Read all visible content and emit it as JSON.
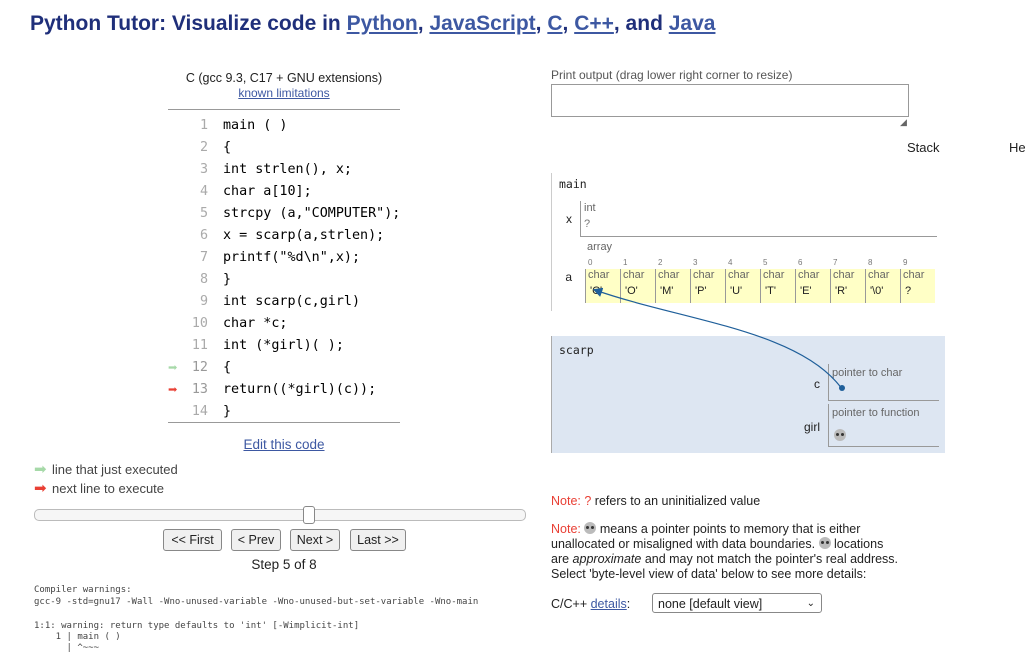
{
  "header": {
    "prefix": "Python Tutor: Visualize code in ",
    "lang1": "Python",
    "sep1": ", ",
    "lang2": "JavaScript",
    "sep2": ", ",
    "lang3": "C",
    "sep3": ", ",
    "lang4": "C++",
    "sep4": ", and ",
    "lang5": "Java"
  },
  "editor": {
    "language": "C (gcc 9.3, C17 + GNU extensions)",
    "limitations_link": "known limitations",
    "lines": [
      {
        "n": "1",
        "code": "main ( )"
      },
      {
        "n": "2",
        "code": "{"
      },
      {
        "n": "3",
        "code": "int strlen(), x;"
      },
      {
        "n": "4",
        "code": "char a[10];"
      },
      {
        "n": "5",
        "code": "strcpy (a,\"COMPUTER\");"
      },
      {
        "n": "6",
        "code": "x = scarp(a,strlen);"
      },
      {
        "n": "7",
        "code": "printf(\"%d\\n\",x);"
      },
      {
        "n": "8",
        "code": "}"
      },
      {
        "n": "9",
        "code": "int scarp(c,girl)"
      },
      {
        "n": "10",
        "code": "char *c;"
      },
      {
        "n": "11",
        "code": "int (*girl)( );"
      },
      {
        "n": "12",
        "code": "{"
      },
      {
        "n": "13",
        "code": "return((*girl)(c));"
      },
      {
        "n": "14",
        "code": "}"
      }
    ],
    "edit_link": "Edit this code",
    "arrow_color_just": "#a6d9a8",
    "arrow_color_next": "#e93f34"
  },
  "legend": {
    "just_executed": "line that just executed",
    "next_line": "next line to execute"
  },
  "controls": {
    "first": "<< First",
    "prev": "< Prev",
    "next": "Next >",
    "last": "Last >>",
    "step_text": "Step 5 of 8",
    "progress": 0.57
  },
  "warnings": {
    "heading": "Compiler warnings:",
    "cmd": "gcc-9 -std=gnu17 -Wall -Wno-unused-variable -Wno-unused-but-set-variable -Wno-main",
    "w1": "1:1: warning: return type defaults to 'int' [-Wimplicit-int]",
    "w2": "    1 | main ( )",
    "w3": "      | ^~~~"
  },
  "output": {
    "label": "Print output (drag lower right corner to resize)",
    "value": ""
  },
  "viz": {
    "stack_label": "Stack",
    "heap_label": "He",
    "main_frame": {
      "name": "main",
      "x_name": "x",
      "x_type": "int",
      "x_value": "?",
      "a_name": "a",
      "a_type": "array",
      "cells": [
        {
          "i": "0",
          "t": "char",
          "v": "'C'"
        },
        {
          "i": "1",
          "t": "char",
          "v": "'O'"
        },
        {
          "i": "2",
          "t": "char",
          "v": "'M'"
        },
        {
          "i": "3",
          "t": "char",
          "v": "'P'"
        },
        {
          "i": "4",
          "t": "char",
          "v": "'U'"
        },
        {
          "i": "5",
          "t": "char",
          "v": "'T'"
        },
        {
          "i": "6",
          "t": "char",
          "v": "'E'"
        },
        {
          "i": "7",
          "t": "char",
          "v": "'R'"
        },
        {
          "i": "8",
          "t": "char",
          "v": "'\\0'"
        },
        {
          "i": "9",
          "t": "char",
          "v": "?"
        }
      ]
    },
    "scarp_frame": {
      "name": "scarp",
      "c_name": "c",
      "c_type": "pointer to char",
      "girl_name": "girl",
      "girl_type": "pointer to function"
    }
  },
  "notes": {
    "note_label": "Note:",
    "uninit_q": "?",
    "uninit_text": " refers to an uninitialized value",
    "n2_a": " means a pointer points to memory that is either",
    "n2_b": "unallocated or misaligned with data boundaries. ",
    "n2_c": " locations",
    "n2_d_pre": "are ",
    "n2_d_em": "approximate",
    "n2_d_post": " and may not match the pointer's real address.",
    "n2_e": "Select 'byte-level view of data' below to see more details:",
    "details_prefix": "C/C++ ",
    "details_link": "details",
    "details_colon": ":",
    "view_select": "none [default view]"
  }
}
